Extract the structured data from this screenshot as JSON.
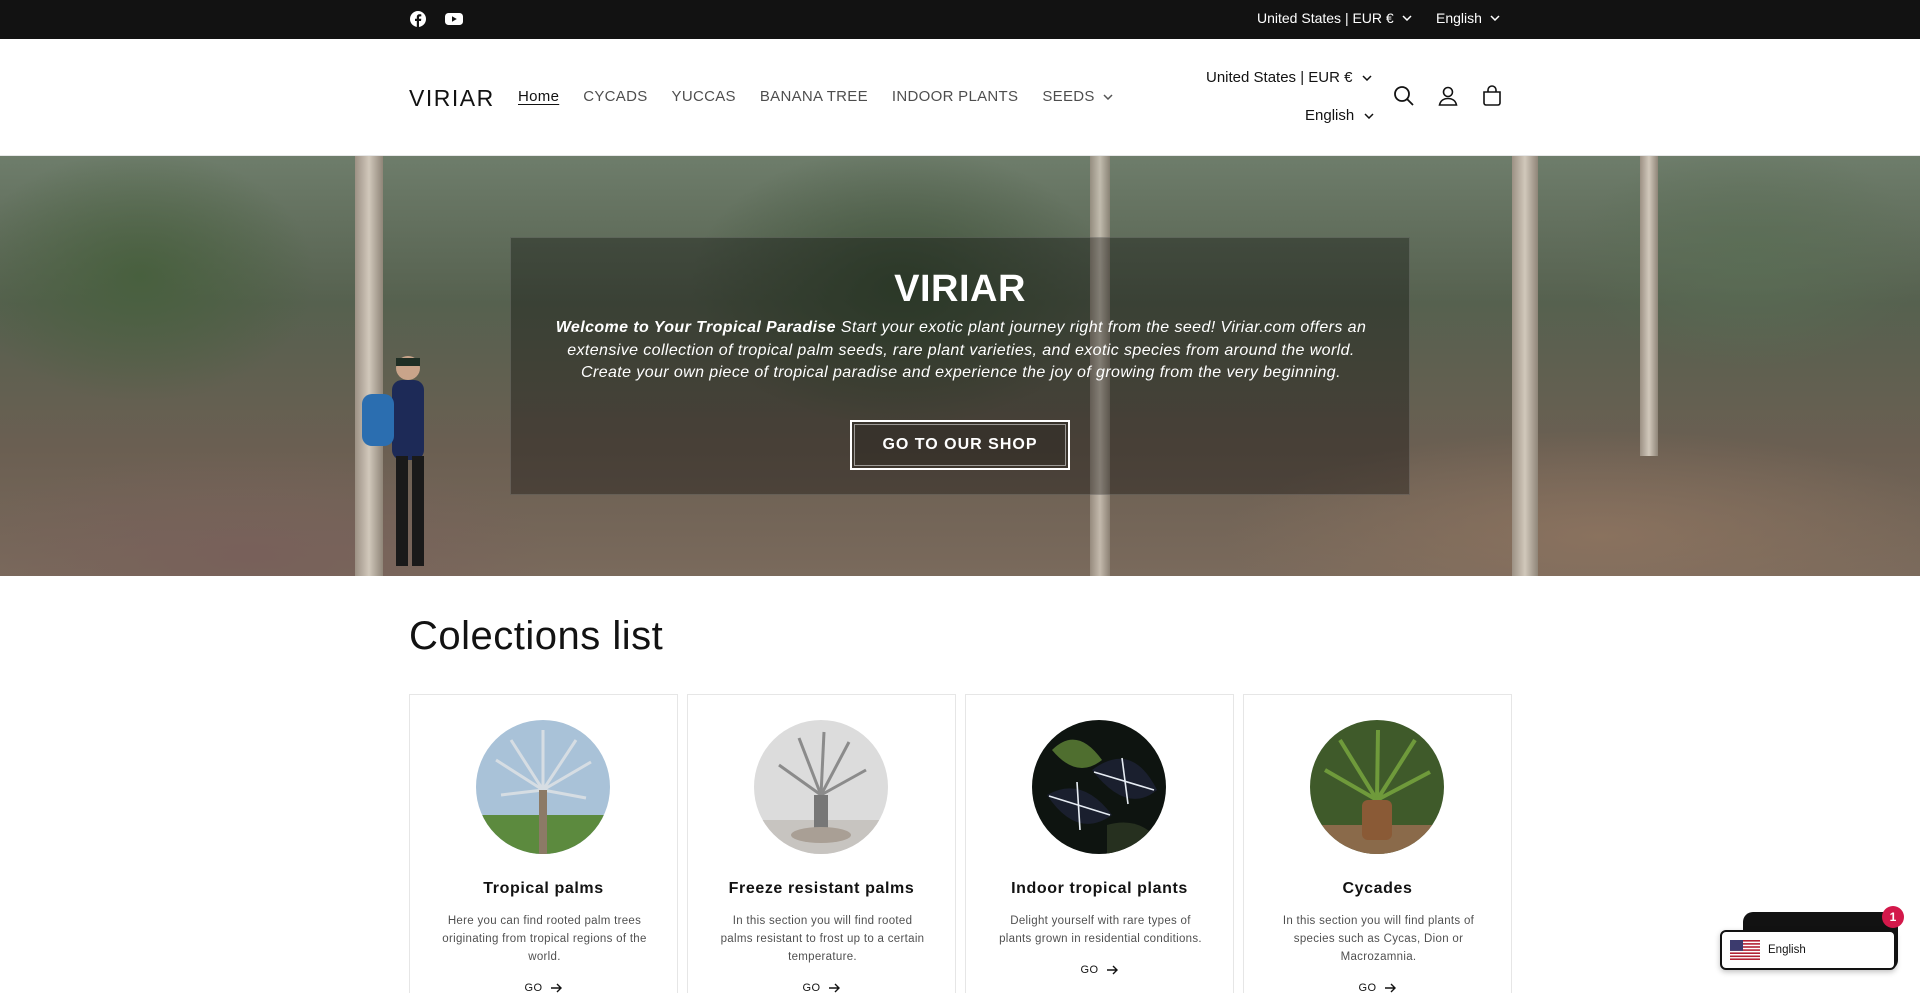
{
  "topbar": {
    "social_icons": [
      "facebook-icon",
      "youtube-icon"
    ],
    "country": "United States | EUR €",
    "language": "English"
  },
  "header": {
    "logo": "VIRIAR",
    "nav": [
      {
        "label": "Home",
        "active": true
      },
      {
        "label": "CYCADS"
      },
      {
        "label": "YUCCAS"
      },
      {
        "label": "BANANA TREE"
      },
      {
        "label": "INDOOR PLANTS"
      },
      {
        "label": "SEEDS",
        "dropdown": true
      }
    ],
    "country": "United States | EUR €",
    "language": "English",
    "icons": [
      "search-icon",
      "account-icon",
      "cart-icon"
    ]
  },
  "hero": {
    "title": "VIRIAR",
    "text_bold": "Welcome to Your Tropical Paradise",
    "text": " Start your exotic plant journey right from the seed! Viriar.com offers an extensive collection of tropical palm seeds, rare plant varieties, and exotic species from around the world. Create your own piece of tropical paradise and experience the joy of growing from the very beginning.",
    "button": "GO TO OUR SHOP"
  },
  "collections": {
    "title": "Colections list",
    "items": [
      {
        "title": "Tropical palms",
        "description": "Here you can find rooted palm trees originating from tropical regions of the world.",
        "link": "GO"
      },
      {
        "title": "Freeze resistant palms",
        "description": "In this section you will find rooted palms resistant to frost up to a certain temperature.",
        "link": "GO"
      },
      {
        "title": "Indoor tropical plants",
        "description": "Delight yourself with rare types of plants grown in residential conditions.",
        "link": "GO"
      },
      {
        "title": "Cycades",
        "description": "In this section you will find plants of species such as Cycas, Dion or Macrozamnia.",
        "link": "GO"
      }
    ]
  },
  "language_widget": {
    "label": "English",
    "badge": "1"
  },
  "colors": {
    "topbar": "#121212",
    "text": "#121212",
    "badge": "#d3184a"
  }
}
